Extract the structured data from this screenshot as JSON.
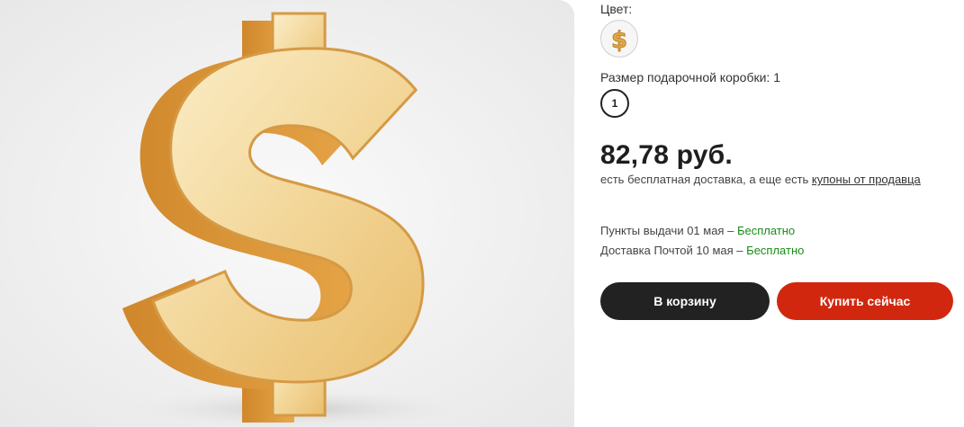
{
  "product": {
    "image_icon": "dollar-sign-icon"
  },
  "options": {
    "color_label": "Цвет:",
    "color_swatch_icon": "dollar-sign-icon",
    "size_label": "Размер подарочной коробки: 1",
    "size_value": "1"
  },
  "pricing": {
    "price": "82,78 руб.",
    "shipping_prefix": "есть бесплатная доставка, а еще есть ",
    "coupon_link": "купоны от продавца"
  },
  "delivery": [
    {
      "text": "Пункты выдачи 01 мая – ",
      "cost": "Бесплатно"
    },
    {
      "text": "Доставка Почтой 10 мая – ",
      "cost": "Бесплатно"
    }
  ],
  "actions": {
    "add_to_cart": "В корзину",
    "buy_now": "Купить сейчас"
  },
  "colors": {
    "buy_button": "#d2270f",
    "cart_button": "#222222",
    "free_text": "#1a8a1a",
    "gold": "#e9b55e"
  }
}
